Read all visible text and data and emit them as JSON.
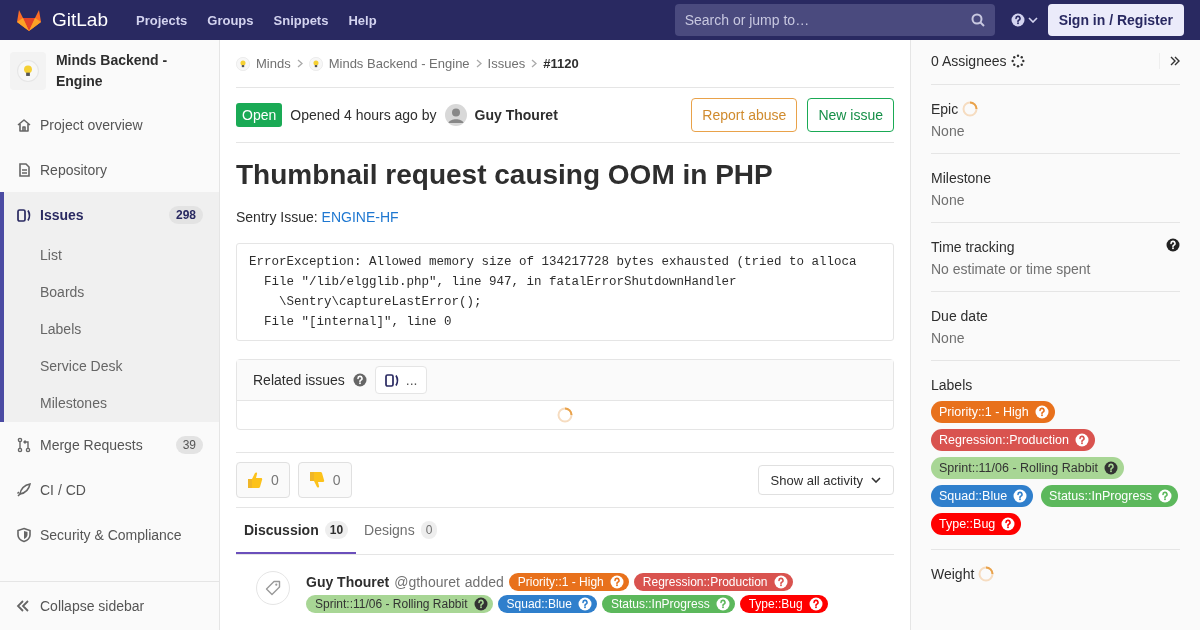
{
  "header": {
    "logo_text": "GitLab",
    "nav": [
      "Projects",
      "Groups",
      "Snippets",
      "Help"
    ],
    "search": {
      "placeholder": "Search or jump to…"
    },
    "sign_in": "Sign in / Register"
  },
  "sidebar": {
    "project_name": "Minds Backend - Engine",
    "items": [
      {
        "label": "Project overview",
        "kind": "home",
        "selected": false
      },
      {
        "label": "Repository",
        "kind": "doc",
        "selected": false
      },
      {
        "label": "Issues",
        "kind": "issues",
        "count": "298",
        "selected": true,
        "children": [
          {
            "label": "List",
            "selected": false
          },
          {
            "label": "Boards",
            "selected": false
          },
          {
            "label": "Labels",
            "selected": false
          },
          {
            "label": "Service Desk",
            "selected": false
          },
          {
            "label": "Milestones",
            "selected": false
          }
        ]
      },
      {
        "label": "Merge Requests",
        "kind": "merge",
        "count": "39",
        "selected": false
      },
      {
        "label": "CI / CD",
        "kind": "rocket",
        "selected": false
      },
      {
        "label": "Security & Compliance",
        "kind": "shield",
        "selected": false
      }
    ],
    "collapse": "Collapse sidebar"
  },
  "breadcrumbs": [
    {
      "label": "Minds",
      "avatar": true,
      "current": false
    },
    {
      "label": "Minds Backend - Engine",
      "avatar": true,
      "current": false
    },
    {
      "label": "Issues",
      "avatar": false,
      "current": false
    },
    {
      "label": "#1120",
      "avatar": false,
      "current": true
    }
  ],
  "issue": {
    "status": "Open",
    "opened": "Opened 4 hours ago by",
    "author": "Guy Thouret",
    "actions": [
      {
        "label": "Report abuse",
        "kind": "warning"
      },
      {
        "label": "New issue",
        "kind": "success"
      }
    ],
    "title": "Thumbnail request causing OOM in PHP",
    "sentry_label": "Sentry Issue:",
    "sentry_link": "ENGINE-HF",
    "code": [
      "ErrorException: Allowed memory size of 134217728 bytes exhausted (tried to alloca",
      "  File \"/lib/elgglib.php\", line 947, in fatalErrorShutdownHandler",
      "    \\Sentry\\captureLastError();",
      "  File \"[internal]\", line 0"
    ]
  },
  "related": {
    "title": "Related issues",
    "button": "..."
  },
  "awards": [
    {
      "kind": "thumbsup",
      "count": "0"
    },
    {
      "kind": "thumbsdown",
      "count": "0"
    }
  ],
  "activity_filter": "Show all activity",
  "tabs": [
    {
      "label": "Discussion",
      "count": "10",
      "selected": true
    },
    {
      "label": "Designs",
      "count": "0",
      "selected": false
    }
  ],
  "note": {
    "author": "Guy Thouret",
    "username": "@gthouret",
    "action": "added",
    "labels": [
      {
        "text": "Priority::1 - High",
        "color": "#e8711c"
      },
      {
        "text": "Regression::Production",
        "color": "#d9534f"
      },
      {
        "text": "Sprint::11/06 - Rolling Rabbit",
        "color": "#a8d695"
      },
      {
        "text": "Squad::Blue",
        "color": "#2f7fcc"
      },
      {
        "text": "Status::InProgress",
        "color": "#5cb85c"
      },
      {
        "text": "Type::Bug",
        "color": "#ff0000"
      }
    ]
  },
  "right": {
    "assignees": "0 Assignees",
    "blocks": [
      {
        "title": "Epic",
        "value": "None",
        "loading": true,
        "help": false
      },
      {
        "title": "Milestone",
        "value": "None",
        "loading": false,
        "help": false
      },
      {
        "title": "Time tracking",
        "value": "No estimate or time spent",
        "loading": false,
        "help": true
      },
      {
        "title": "Due date",
        "value": "None",
        "loading": false,
        "help": false
      }
    ],
    "labels_title": "Labels",
    "labels": [
      {
        "text": "Priority::1 - High",
        "color": "#e8711c"
      },
      {
        "text": "Regression::Production",
        "color": "#d9534f"
      },
      {
        "text": "Sprint::11/06 - Rolling Rabbit",
        "color": "#a8d695"
      },
      {
        "text": "Squad::Blue",
        "color": "#2f7fcc"
      },
      {
        "text": "Status::InProgress",
        "color": "#5cb85c"
      },
      {
        "text": "Type::Bug",
        "color": "#ff0000"
      }
    ],
    "weight": "Weight"
  }
}
